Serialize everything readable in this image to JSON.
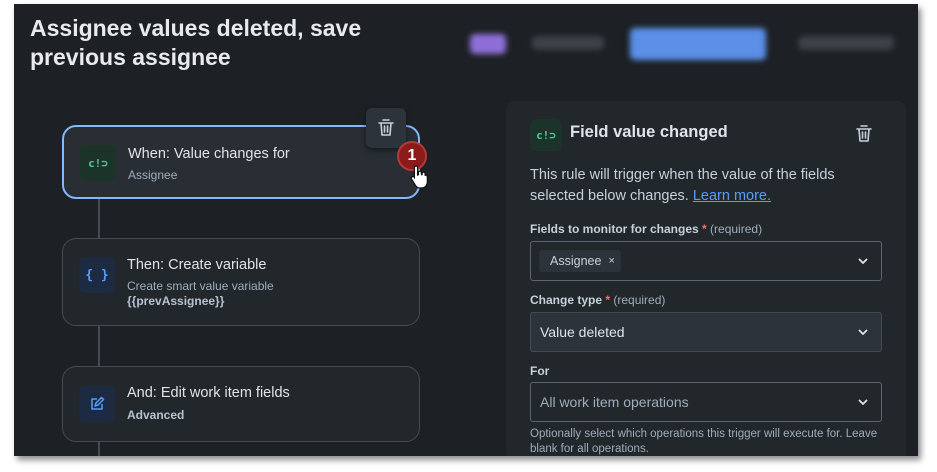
{
  "header": {
    "title_line1": "Assignee values deleted, save",
    "title_line2": "previous assignee"
  },
  "flow": {
    "nodes": [
      {
        "title": "When: Value changes for",
        "subtitle": "Assignee",
        "icon": "field-change-icon",
        "icon_text": "c!⊃",
        "selected": true
      },
      {
        "title": "Then: Create variable",
        "subtitle": "Create smart value variable",
        "subtitle_strong": "{{prevAssignee}}",
        "icon": "variable-braces-icon",
        "icon_text": "{ }"
      },
      {
        "title": "And: Edit work item fields",
        "subtitle_strong": "Advanced",
        "icon": "edit-pencil-icon"
      }
    ],
    "badge": "1"
  },
  "panel": {
    "icon_text": "c!⊃",
    "title": "Field value changed",
    "description": "This rule will trigger when the value of the fields selected below changes.",
    "learn_more": "Learn more.",
    "fields_label": "Fields to monitor for changes",
    "required_mark": "*",
    "required_text": "(required)",
    "fields_tag": "Assignee",
    "tag_remove": "×",
    "change_type_label": "Change type",
    "change_type_value": "Value deleted",
    "for_label": "For",
    "for_placeholder": "All work item operations",
    "help_text": "Optionally select which operations this trigger will execute for. Leave blank for all operations."
  },
  "colors": {
    "background": "#1d2125",
    "accent": "#85b8ff",
    "badge": "#8b1a1a",
    "trigger_icon": "#4bce97",
    "action_icon": "#579dff"
  }
}
